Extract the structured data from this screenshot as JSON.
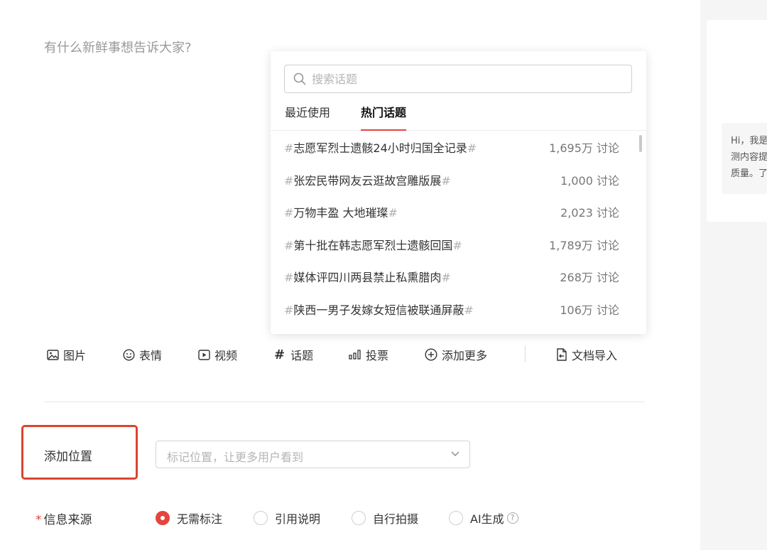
{
  "composer": {
    "placeholder": "有什么新鲜事想告诉大家?"
  },
  "topic_popup": {
    "search_placeholder": "搜索话题",
    "tabs": [
      {
        "label": "最近使用"
      },
      {
        "label": "热门话题",
        "active": true
      }
    ],
    "topics": [
      {
        "name": "志愿军烈士遗骸24小时归国全记录",
        "count": "1,695万 讨论"
      },
      {
        "name": "张宏民带网友云逛故宫雕版展",
        "count": "1,000 讨论"
      },
      {
        "name": "万物丰盈 大地璀璨",
        "count": "2,023 讨论"
      },
      {
        "name": "第十批在韩志愿军烈士遗骸回国",
        "count": "1,789万 讨论"
      },
      {
        "name": "媒体评四川两县禁止私熏腊肉",
        "count": "268万 讨论"
      },
      {
        "name": "陕西一男子发嫁女短信被联通屏蔽",
        "count": "106万 讨论"
      }
    ],
    "hash": "#"
  },
  "toolbar": {
    "image": "图片",
    "emoji": "表情",
    "video": "视频",
    "topic": "话题",
    "vote": "投票",
    "more": "添加更多",
    "import": "文档导入",
    "topic_icon": "#"
  },
  "location": {
    "label": "添加位置",
    "placeholder": "标记位置，让更多用户看到"
  },
  "source": {
    "required_mark": "*",
    "label": "信息来源",
    "options": [
      {
        "label": "无需标注",
        "checked": true
      },
      {
        "label": "引用说明"
      },
      {
        "label": "自行拍摄"
      },
      {
        "label": "AI生成"
      }
    ],
    "help_icon": "?"
  },
  "assistant_tip": {
    "lines": [
      "Hi，我是",
      "测内容提",
      "质量。了"
    ]
  },
  "colors": {
    "accent": "#e5443f",
    "highlight": "#d9452e"
  }
}
